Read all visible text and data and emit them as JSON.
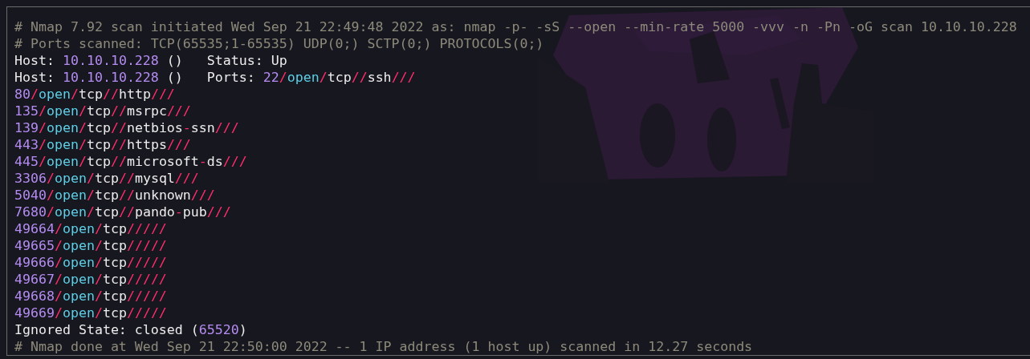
{
  "background": {
    "kind": "picture"
  },
  "lines": [
    [
      {
        "text": "# Nmap 7.92 scan initiated Wed Sep 21 22:49:48 2022 as: nmap -p- -sS --open --min-rate 5000 -vvv -n -Pn -oG scan 10.10.10.228",
        "kind": "comment"
      }
    ],
    [
      {
        "text": "# Ports scanned: TCP(65535;1-65535) UDP(0;) SCTP(0;) PROTOCOLS(0;)",
        "kind": "comment"
      }
    ],
    [
      {
        "text": "Host: ",
        "kind": "plain"
      },
      {
        "text": "10.10.10.228",
        "kind": "number"
      },
      {
        "text": " ()   Status: Up",
        "kind": "plain"
      }
    ],
    [
      {
        "text": "Host: ",
        "kind": "plain"
      },
      {
        "text": "10.10.10.228",
        "kind": "number"
      },
      {
        "text": " ()   Ports: ",
        "kind": "plain"
      },
      {
        "text": "22",
        "kind": "number"
      },
      {
        "text": "/",
        "kind": "separator"
      },
      {
        "text": "open",
        "kind": "state"
      },
      {
        "text": "/",
        "kind": "separator"
      },
      {
        "text": "tcp",
        "kind": "plain"
      },
      {
        "text": "//",
        "kind": "separator"
      },
      {
        "text": "ssh",
        "kind": "plain"
      },
      {
        "text": "///",
        "kind": "separator"
      }
    ],
    [
      {
        "text": "80",
        "kind": "number"
      },
      {
        "text": "/",
        "kind": "separator"
      },
      {
        "text": "open",
        "kind": "state"
      },
      {
        "text": "/",
        "kind": "separator"
      },
      {
        "text": "tcp",
        "kind": "plain"
      },
      {
        "text": "//",
        "kind": "separator"
      },
      {
        "text": "http",
        "kind": "plain"
      },
      {
        "text": "///",
        "kind": "separator"
      }
    ],
    [
      {
        "text": "135",
        "kind": "number"
      },
      {
        "text": "/",
        "kind": "separator"
      },
      {
        "text": "open",
        "kind": "state"
      },
      {
        "text": "/",
        "kind": "separator"
      },
      {
        "text": "tcp",
        "kind": "plain"
      },
      {
        "text": "//",
        "kind": "separator"
      },
      {
        "text": "msrpc",
        "kind": "plain"
      },
      {
        "text": "///",
        "kind": "separator"
      }
    ],
    [
      {
        "text": "139",
        "kind": "number"
      },
      {
        "text": "/",
        "kind": "separator"
      },
      {
        "text": "open",
        "kind": "state"
      },
      {
        "text": "/",
        "kind": "separator"
      },
      {
        "text": "tcp",
        "kind": "plain"
      },
      {
        "text": "//",
        "kind": "separator"
      },
      {
        "text": "netbios",
        "kind": "plain"
      },
      {
        "text": "-",
        "kind": "separator"
      },
      {
        "text": "ssn",
        "kind": "plain"
      },
      {
        "text": "///",
        "kind": "separator"
      }
    ],
    [
      {
        "text": "443",
        "kind": "number"
      },
      {
        "text": "/",
        "kind": "separator"
      },
      {
        "text": "open",
        "kind": "state"
      },
      {
        "text": "/",
        "kind": "separator"
      },
      {
        "text": "tcp",
        "kind": "plain"
      },
      {
        "text": "//",
        "kind": "separator"
      },
      {
        "text": "https",
        "kind": "plain"
      },
      {
        "text": "///",
        "kind": "separator"
      }
    ],
    [
      {
        "text": "445",
        "kind": "number"
      },
      {
        "text": "/",
        "kind": "separator"
      },
      {
        "text": "open",
        "kind": "state"
      },
      {
        "text": "/",
        "kind": "separator"
      },
      {
        "text": "tcp",
        "kind": "plain"
      },
      {
        "text": "//",
        "kind": "separator"
      },
      {
        "text": "microsoft",
        "kind": "plain"
      },
      {
        "text": "-",
        "kind": "separator"
      },
      {
        "text": "ds",
        "kind": "plain"
      },
      {
        "text": "///",
        "kind": "separator"
      }
    ],
    [
      {
        "text": "3306",
        "kind": "number"
      },
      {
        "text": "/",
        "kind": "separator"
      },
      {
        "text": "open",
        "kind": "state"
      },
      {
        "text": "/",
        "kind": "separator"
      },
      {
        "text": "tcp",
        "kind": "plain"
      },
      {
        "text": "//",
        "kind": "separator"
      },
      {
        "text": "mysql",
        "kind": "plain"
      },
      {
        "text": "///",
        "kind": "separator"
      }
    ],
    [
      {
        "text": "5040",
        "kind": "number"
      },
      {
        "text": "/",
        "kind": "separator"
      },
      {
        "text": "open",
        "kind": "state"
      },
      {
        "text": "/",
        "kind": "separator"
      },
      {
        "text": "tcp",
        "kind": "plain"
      },
      {
        "text": "//",
        "kind": "separator"
      },
      {
        "text": "unknown",
        "kind": "plain"
      },
      {
        "text": "///",
        "kind": "separator"
      }
    ],
    [
      {
        "text": "7680",
        "kind": "number"
      },
      {
        "text": "/",
        "kind": "separator"
      },
      {
        "text": "open",
        "kind": "state"
      },
      {
        "text": "/",
        "kind": "separator"
      },
      {
        "text": "tcp",
        "kind": "plain"
      },
      {
        "text": "//",
        "kind": "separator"
      },
      {
        "text": "pando",
        "kind": "plain"
      },
      {
        "text": "-",
        "kind": "separator"
      },
      {
        "text": "pub",
        "kind": "plain"
      },
      {
        "text": "///",
        "kind": "separator"
      }
    ],
    [
      {
        "text": "49664",
        "kind": "number"
      },
      {
        "text": "/",
        "kind": "separator"
      },
      {
        "text": "open",
        "kind": "state"
      },
      {
        "text": "/",
        "kind": "separator"
      },
      {
        "text": "tcp",
        "kind": "plain"
      },
      {
        "text": "/////",
        "kind": "separator"
      }
    ],
    [
      {
        "text": "49665",
        "kind": "number"
      },
      {
        "text": "/",
        "kind": "separator"
      },
      {
        "text": "open",
        "kind": "state"
      },
      {
        "text": "/",
        "kind": "separator"
      },
      {
        "text": "tcp",
        "kind": "plain"
      },
      {
        "text": "/////",
        "kind": "separator"
      }
    ],
    [
      {
        "text": "49666",
        "kind": "number"
      },
      {
        "text": "/",
        "kind": "separator"
      },
      {
        "text": "open",
        "kind": "state"
      },
      {
        "text": "/",
        "kind": "separator"
      },
      {
        "text": "tcp",
        "kind": "plain"
      },
      {
        "text": "/////",
        "kind": "separator"
      }
    ],
    [
      {
        "text": "49667",
        "kind": "number"
      },
      {
        "text": "/",
        "kind": "separator"
      },
      {
        "text": "open",
        "kind": "state"
      },
      {
        "text": "/",
        "kind": "separator"
      },
      {
        "text": "tcp",
        "kind": "plain"
      },
      {
        "text": "/////",
        "kind": "separator"
      }
    ],
    [
      {
        "text": "49668",
        "kind": "number"
      },
      {
        "text": "/",
        "kind": "separator"
      },
      {
        "text": "open",
        "kind": "state"
      },
      {
        "text": "/",
        "kind": "separator"
      },
      {
        "text": "tcp",
        "kind": "plain"
      },
      {
        "text": "/////",
        "kind": "separator"
      }
    ],
    [
      {
        "text": "49669",
        "kind": "number"
      },
      {
        "text": "/",
        "kind": "separator"
      },
      {
        "text": "open",
        "kind": "state"
      },
      {
        "text": "/",
        "kind": "separator"
      },
      {
        "text": "tcp",
        "kind": "plain"
      },
      {
        "text": "/////",
        "kind": "separator"
      }
    ],
    [
      {
        "text": "Ignored State: closed (",
        "kind": "plain"
      },
      {
        "text": "65520",
        "kind": "number"
      },
      {
        "text": ")",
        "kind": "plain"
      }
    ],
    [
      {
        "text": "# Nmap done at Wed Sep 21 22:50:00 2022 -- 1 IP address (1 host up) scanned in 12.27 seconds",
        "kind": "comment"
      }
    ]
  ]
}
